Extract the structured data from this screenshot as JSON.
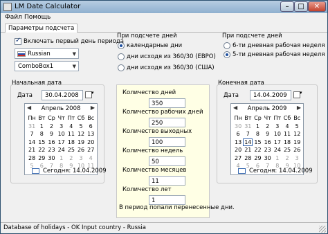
{
  "window": {
    "title": "LM Date Calculator"
  },
  "menu": [
    "Файл",
    "Помощь"
  ],
  "tabs": [
    "Параметры подсчета"
  ],
  "options": {
    "first_day_label": "Включать первый день периода",
    "first_day_checked": true,
    "country": "Russian",
    "combo2": "ComboBox1"
  },
  "count_group": {
    "title": "При подсчете дней",
    "options": [
      "календарные дни",
      "дни исходя из 360/30 (ЕВРО)",
      "дни исходя из 360/30 (США)"
    ],
    "selected": 0
  },
  "week_group": {
    "title": "При подсчете дней",
    "options": [
      "6-ти дневная рабочая неделя",
      "5-ти дневная рабочая неделя"
    ],
    "selected": 1
  },
  "start": {
    "title": "Начальная дата",
    "date_label": "Дата",
    "date": "30.04.2008",
    "month": "Апрель 2008",
    "weekdays": [
      "Пн",
      "Вт",
      "Ср",
      "Чт",
      "Пт",
      "Сб",
      "Вс"
    ],
    "rows": [
      [
        "31",
        "1",
        "2",
        "3",
        "4",
        "5",
        "6"
      ],
      [
        "7",
        "8",
        "9",
        "10",
        "11",
        "12",
        "13"
      ],
      [
        "14",
        "15",
        "16",
        "17",
        "18",
        "19",
        "20"
      ],
      [
        "21",
        "22",
        "23",
        "24",
        "25",
        "26",
        "27"
      ],
      [
        "28",
        "29",
        "30",
        "1",
        "2",
        "3",
        "4"
      ],
      [
        "5",
        "6",
        "7",
        "8",
        "9",
        "10",
        "11"
      ]
    ],
    "today_label": "Сегодня: 14.04.2009"
  },
  "end": {
    "title": "Конечная дата",
    "date_label": "Дата",
    "date": "14.04.2009",
    "month": "Апрель 2009",
    "weekdays": [
      "Пн",
      "Вт",
      "Ср",
      "Чт",
      "Пт",
      "Сб",
      "Вс"
    ],
    "rows": [
      [
        "30",
        "31",
        "1",
        "2",
        "3",
        "4",
        "5"
      ],
      [
        "6",
        "7",
        "8",
        "9",
        "10",
        "11",
        "12"
      ],
      [
        "13",
        "14",
        "15",
        "16",
        "17",
        "18",
        "19"
      ],
      [
        "20",
        "21",
        "22",
        "23",
        "24",
        "25",
        "26"
      ],
      [
        "27",
        "28",
        "29",
        "30",
        "1",
        "2",
        "3"
      ],
      [
        "4",
        "5",
        "6",
        "7",
        "8",
        "9",
        "10"
      ]
    ],
    "today_label": "Сегодня: 14.04.2009"
  },
  "results": [
    {
      "label": "Количество дней",
      "value": "350"
    },
    {
      "label": "Количество рабочих дней",
      "value": "250"
    },
    {
      "label": "Количество выходных",
      "value": "100"
    },
    {
      "label": "Количество недель",
      "value": "50"
    },
    {
      "label": "Количество месяцев",
      "value": "11"
    },
    {
      "label": "Количество лет",
      "value": "1"
    }
  ],
  "note": "В период попали перенесенные дни.",
  "status": "Database of holidays - OK  Input country - Russia"
}
